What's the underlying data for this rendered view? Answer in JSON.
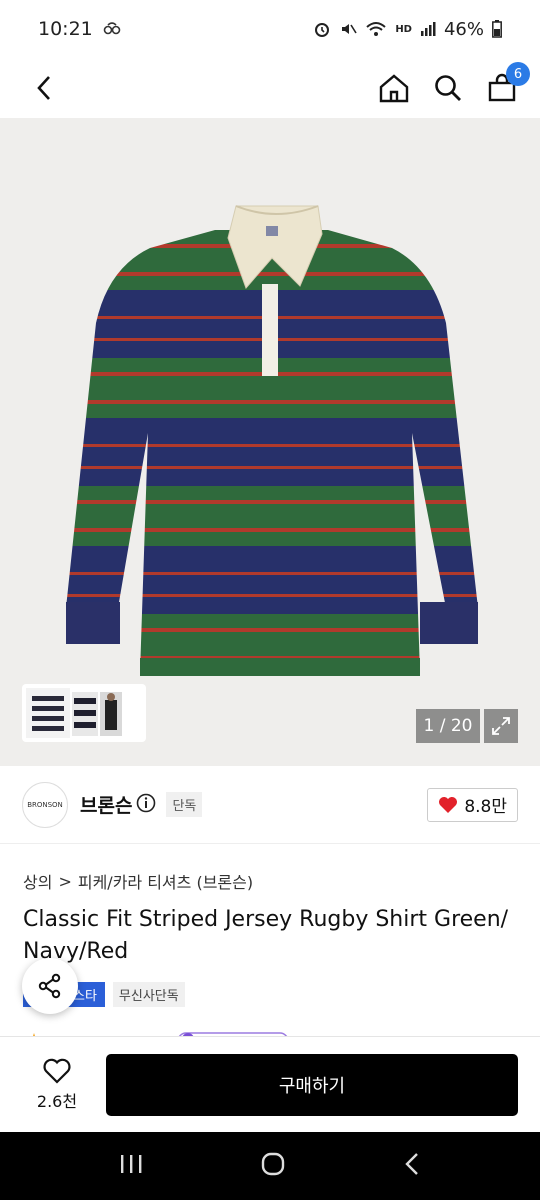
{
  "status": {
    "time": "10:21",
    "battery": "46%",
    "network_label": "HD"
  },
  "header": {
    "cart_count": "6"
  },
  "gallery": {
    "counter": "1 / 20"
  },
  "brand": {
    "name": "브론슨",
    "logo_text": "BRONSON",
    "exclusive_tag": "단독",
    "likes": "8.8만"
  },
  "breadcrumb": {
    "category": "상의",
    "separator": ">",
    "subcategory": "피케/카라 티셔츠 (브론슨)"
  },
  "product": {
    "title": "Classic Fit Striped Jersey Rugby Shirt Green/Navy/Red",
    "tag_primary": "스타",
    "tag_secondary": "무신사단독"
  },
  "bottom": {
    "wish_count": "2.6천",
    "buy_label": "구매하기"
  },
  "colors": {
    "accent_blue": "#2b7be6",
    "like_red": "#e2222b",
    "shirt_green": "#2f6a3c",
    "shirt_navy": "#27306a",
    "shirt_red": "#b13a2c",
    "collar_cream": "#ece5cf"
  }
}
